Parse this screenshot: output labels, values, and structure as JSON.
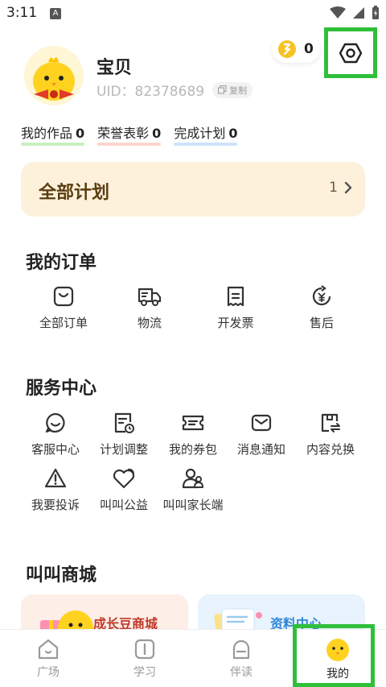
{
  "status_bar": {
    "time": "3:11",
    "notification": "A"
  },
  "profile": {
    "name": "宝贝",
    "uid": "UID：82378689",
    "copy_label": "复制"
  },
  "coins": {
    "count": "0"
  },
  "stats": [
    {
      "label": "我的作品",
      "value": "0",
      "color": "#c9efc0"
    },
    {
      "label": "荣誉表彰",
      "value": "0",
      "color": "#fbd6cc"
    },
    {
      "label": "完成计划",
      "value": "0",
      "color": "#cde3fb"
    }
  ],
  "plans": {
    "title": "全部计划",
    "count": "1"
  },
  "orders": {
    "title": "我的订单",
    "items": [
      {
        "label": "全部订单",
        "icon": "bag-icon"
      },
      {
        "label": "物流",
        "icon": "truck-icon"
      },
      {
        "label": "开发票",
        "icon": "receipt-icon"
      },
      {
        "label": "售后",
        "icon": "refund-icon"
      }
    ]
  },
  "services": {
    "title": "服务中心",
    "items": [
      {
        "label": "客服中心",
        "icon": "chat-icon"
      },
      {
        "label": "计划调整",
        "icon": "schedule-icon"
      },
      {
        "label": "我的券包",
        "icon": "ticket-icon"
      },
      {
        "label": "消息通知",
        "icon": "mail-icon"
      },
      {
        "label": "内容兑换",
        "icon": "exchange-icon"
      },
      {
        "label": "我要投诉",
        "icon": "warning-icon"
      },
      {
        "label": "叫叫公益",
        "icon": "heart-icon"
      },
      {
        "label": "叫叫家长端",
        "icon": "parents-icon"
      }
    ]
  },
  "mall": {
    "title": "叫叫商城",
    "cards": [
      {
        "label": "成长豆商城",
        "color": "#c0392b"
      },
      {
        "label": "资料中心",
        "color": "#2f86d6"
      }
    ]
  },
  "tabbar": {
    "tabs": [
      {
        "label": "广场",
        "icon": "home-icon"
      },
      {
        "label": "学习",
        "icon": "book-icon"
      },
      {
        "label": "伴读",
        "icon": "companion-icon"
      },
      {
        "label": "我的",
        "icon": "profile-face-icon"
      }
    ],
    "active_index": 3
  },
  "colors": {
    "accent_highlight": "#2fbf3a",
    "plan_card_bg": "#fdf1dc",
    "coin_yellow": "#f6c324"
  }
}
